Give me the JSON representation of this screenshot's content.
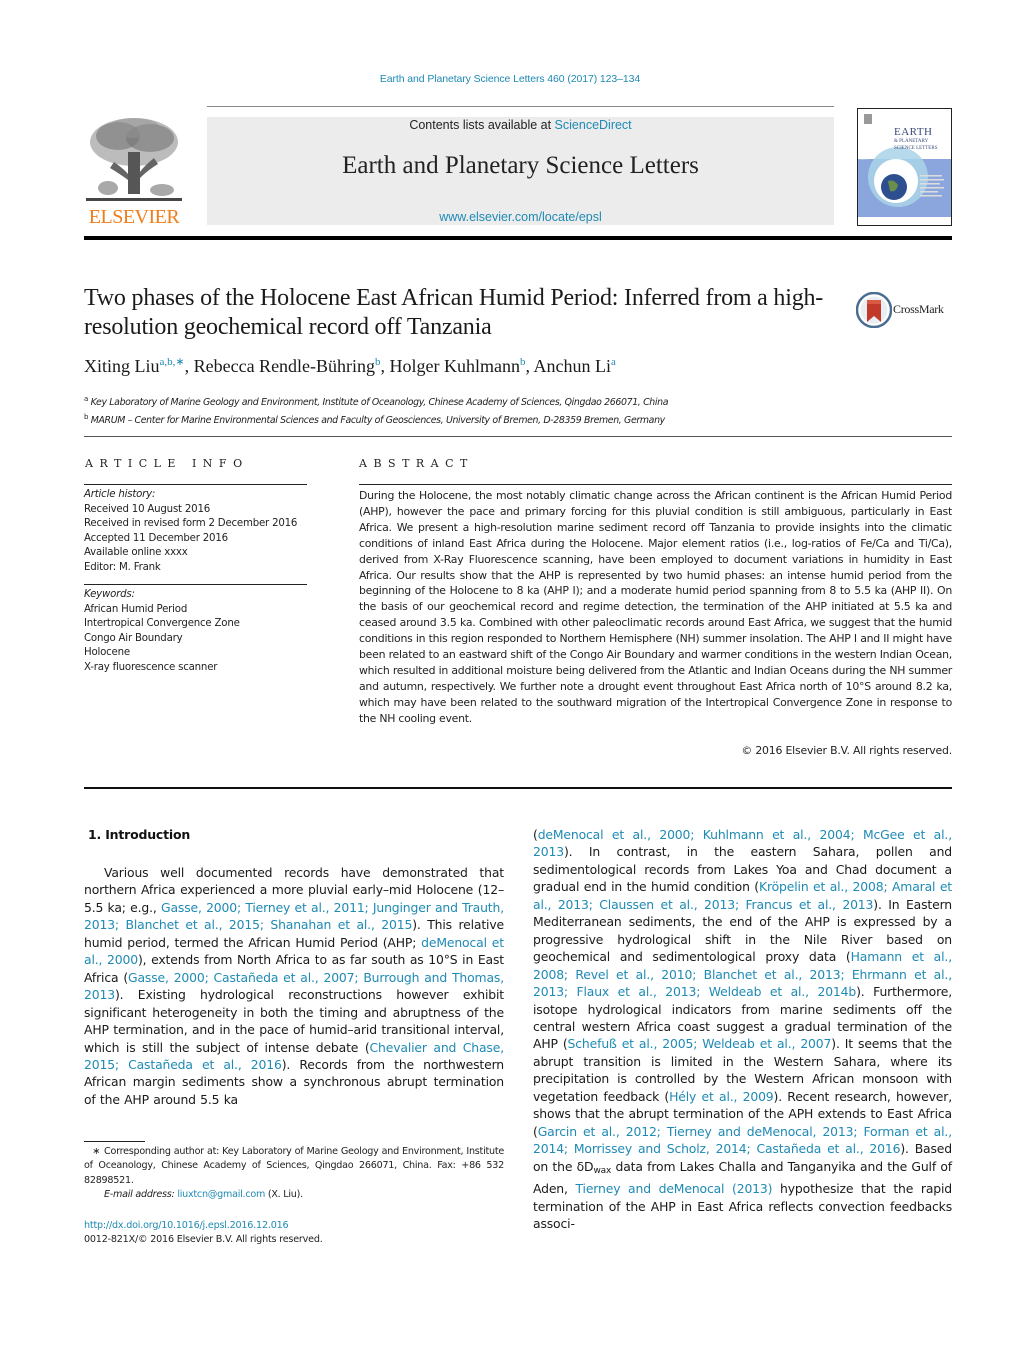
{
  "running_head": "Earth and Planetary Science Letters 460 (2017) 123–134",
  "masthead": {
    "publisher_wordmark": "ELSEVIER",
    "contents_prefix": "Contents lists available at ",
    "contents_link": "ScienceDirect",
    "journal_title": "Earth and Planetary Science Letters",
    "journal_url": "www.elsevier.com/locate/epsl",
    "cover_title_lines": [
      "EARTH",
      "& PLANETARY",
      "SCIENCE LETTERS"
    ],
    "cover_icon": "globe-icon",
    "logo_icon": "elsevier-tree-icon"
  },
  "crossmark": {
    "label": "CrossMark",
    "icon": "crossmark-icon"
  },
  "article": {
    "title": "Two phases of the Holocene East African Humid Period: Inferred from a high-resolution geochemical record off Tanzania",
    "authors": [
      {
        "name": "Xiting Liu",
        "sup": "a,b,∗",
        "sep": ", "
      },
      {
        "name": "Rebecca Rendle-Bühring",
        "sup": "b",
        "sep": ", "
      },
      {
        "name": "Holger Kuhlmann",
        "sup": "b",
        "sep": ", "
      },
      {
        "name": "Anchun Li",
        "sup": "a",
        "sep": ""
      }
    ],
    "affiliations": [
      {
        "mark": "a",
        "text": "Key Laboratory of Marine Geology and Environment, Institute of Oceanology, Chinese Academy of Sciences, Qingdao 266071, China"
      },
      {
        "mark": "b",
        "text": "MARUM – Center for Marine Environmental Sciences and Faculty of Geosciences, University of Bremen, D-28359 Bremen, Germany"
      }
    ]
  },
  "article_info": {
    "heading": "ARTICLE INFO",
    "history_label": "Article history:",
    "history": [
      "Received 10 August 2016",
      "Received in revised form 2 December 2016",
      "Accepted 11 December 2016",
      "Available online xxxx",
      "Editor: M. Frank"
    ],
    "keywords_label": "Keywords:",
    "keywords": [
      "African Humid Period",
      "Intertropical Convergence Zone",
      "Congo Air Boundary",
      "Holocene",
      "X-ray fluorescence scanner"
    ]
  },
  "abstract": {
    "heading": "ABSTRACT",
    "text": "During the Holocene, the most notably climatic change across the African continent is the African Humid Period (AHP), however the pace and primary forcing for this pluvial condition is still ambiguous, particularly in East Africa. We present a high-resolution marine sediment record off Tanzania to provide insights into the climatic conditions of inland East Africa during the Holocene. Major element ratios (i.e., log-ratios of Fe/Ca and Ti/Ca), derived from X-Ray Fluorescence scanning, have been employed to document variations in humidity in East Africa. Our results show that the AHP is represented by two humid phases: an intense humid period from the beginning of the Holocene to 8 ka (AHP I); and a moderate humid period spanning from 8 to 5.5 ka (AHP II). On the basis of our geochemical record and regime detection, the termination of the AHP initiated at 5.5 ka and ceased around 3.5 ka. Combined with other paleoclimatic records around East Africa, we suggest that the humid conditions in this region responded to Northern Hemisphere (NH) summer insolation. The AHP I and II might have been related to an eastward shift of the Congo Air Boundary and warmer conditions in the western Indian Ocean, which resulted in additional moisture being delivered from the Atlantic and Indian Oceans during the NH summer and autumn, respectively. We further note a drought event throughout East Africa north of 10°S around 8.2 ka, which may have been related to the southward migration of the Intertropical Convergence Zone in response to the NH cooling event.",
    "copyright": "© 2016 Elsevier B.V. All rights reserved."
  },
  "body": {
    "section_heading": "1. Introduction",
    "left_segments": [
      {
        "t": "Various well documented records have demonstrated that northern Africa experienced a more pluvial early–mid Holocene (12–5.5 ka; e.g., "
      },
      {
        "t": "Gasse, 2000; Tierney et al., 2011; Junginger and Trauth, 2013; Blanchet et al., 2015; Shanahan et al., 2015",
        "link": true
      },
      {
        "t": "). This relative humid period, termed the African Humid Period (AHP; "
      },
      {
        "t": "deMenocal et al., 2000",
        "link": true
      },
      {
        "t": "), extends from North Africa to as far south as 10°S in East Africa ("
      },
      {
        "t": "Gasse, 2000; Castañeda et al., 2007; Burrough and Thomas, 2013",
        "link": true
      },
      {
        "t": "). Existing hydrological reconstructions however exhibit significant heterogeneity in both the timing and abruptness of the AHP termination, and in the pace of humid–arid transitional interval, which is still the subject of intense debate ("
      },
      {
        "t": "Chevalier and Chase, 2015; Castañeda et al., 2016",
        "link": true
      },
      {
        "t": "). Records from the northwestern African margin sediments show a synchronous abrupt termination of the AHP around 5.5 ka"
      }
    ],
    "right_segments": [
      {
        "t": "("
      },
      {
        "t": "deMenocal et al., 2000; Kuhlmann et al., 2004; McGee et al., 2013",
        "link": true
      },
      {
        "t": "). In contrast, in the eastern Sahara, pollen and sedimentological records from Lakes Yoa and Chad document a gradual end in the humid condition ("
      },
      {
        "t": "Kröpelin et al., 2008; Amaral et al., 2013; Claussen et al., 2013; Francus et al., 2013",
        "link": true
      },
      {
        "t": "). In Eastern Mediterranean sediments, the end of the AHP is expressed by a progressive hydrological shift in the Nile River based on geochemical and sedimentological proxy data ("
      },
      {
        "t": "Hamann et al., 2008; Revel et al., 2010; Blanchet et al., 2013; Ehrmann et al., 2013; Flaux et al., 2013; Weldeab et al., 2014b",
        "link": true
      },
      {
        "t": "). Furthermore, isotope hydrological indicators from marine sediments off the central western Africa coast suggest a gradual termination of the AHP ("
      },
      {
        "t": "Schefuß et al., 2005; Weldeab et al., 2007",
        "link": true
      },
      {
        "t": "). It seems that the abrupt transition is limited in the Western Sahara, where its precipitation is controlled by the Western African monsoon with vegetation feedback ("
      },
      {
        "t": "Hély et al., 2009",
        "link": true
      },
      {
        "t": "). Recent research, however, shows that the abrupt termination of the APH extends to East Africa ("
      },
      {
        "t": "Garcin et al., 2012; Tierney and deMenocal, 2013; Forman et al., 2014; Morrissey and Scholz, 2014; Castañeda et al., 2016",
        "link": true
      },
      {
        "t": "). Based on the δD"
      },
      {
        "t": "wax",
        "sub": true
      },
      {
        "t": " data from Lakes Challa and Tanganyika and the Gulf of Aden, "
      },
      {
        "t": "Tierney and deMenocal (2013)",
        "link": true
      },
      {
        "t": " hypothesize that the rapid termination of the AHP in East Africa reflects convection feedbacks associ-"
      }
    ]
  },
  "footnote": {
    "star": "∗",
    "corresponding": "Corresponding author at: Key Laboratory of Marine Geology and Environment, Institute of Oceanology, Chinese Academy of Sciences, Qingdao 266071, China. Fax: +86 532 82898521.",
    "email_label": "E-mail address:",
    "email": "liuxtcn@gmail.com",
    "email_suffix": " (X. Liu)."
  },
  "doi": {
    "url": "http://dx.doi.org/10.1016/j.epsl.2016.12.016",
    "rights": "0012-821X/© 2016 Elsevier B.V. All rights reserved."
  },
  "colors": {
    "link": "#1f8ab4",
    "elsevier_orange": "#f07c1a",
    "masthead_bg": "#ececec",
    "cover_blue": "#8aa6dc"
  }
}
